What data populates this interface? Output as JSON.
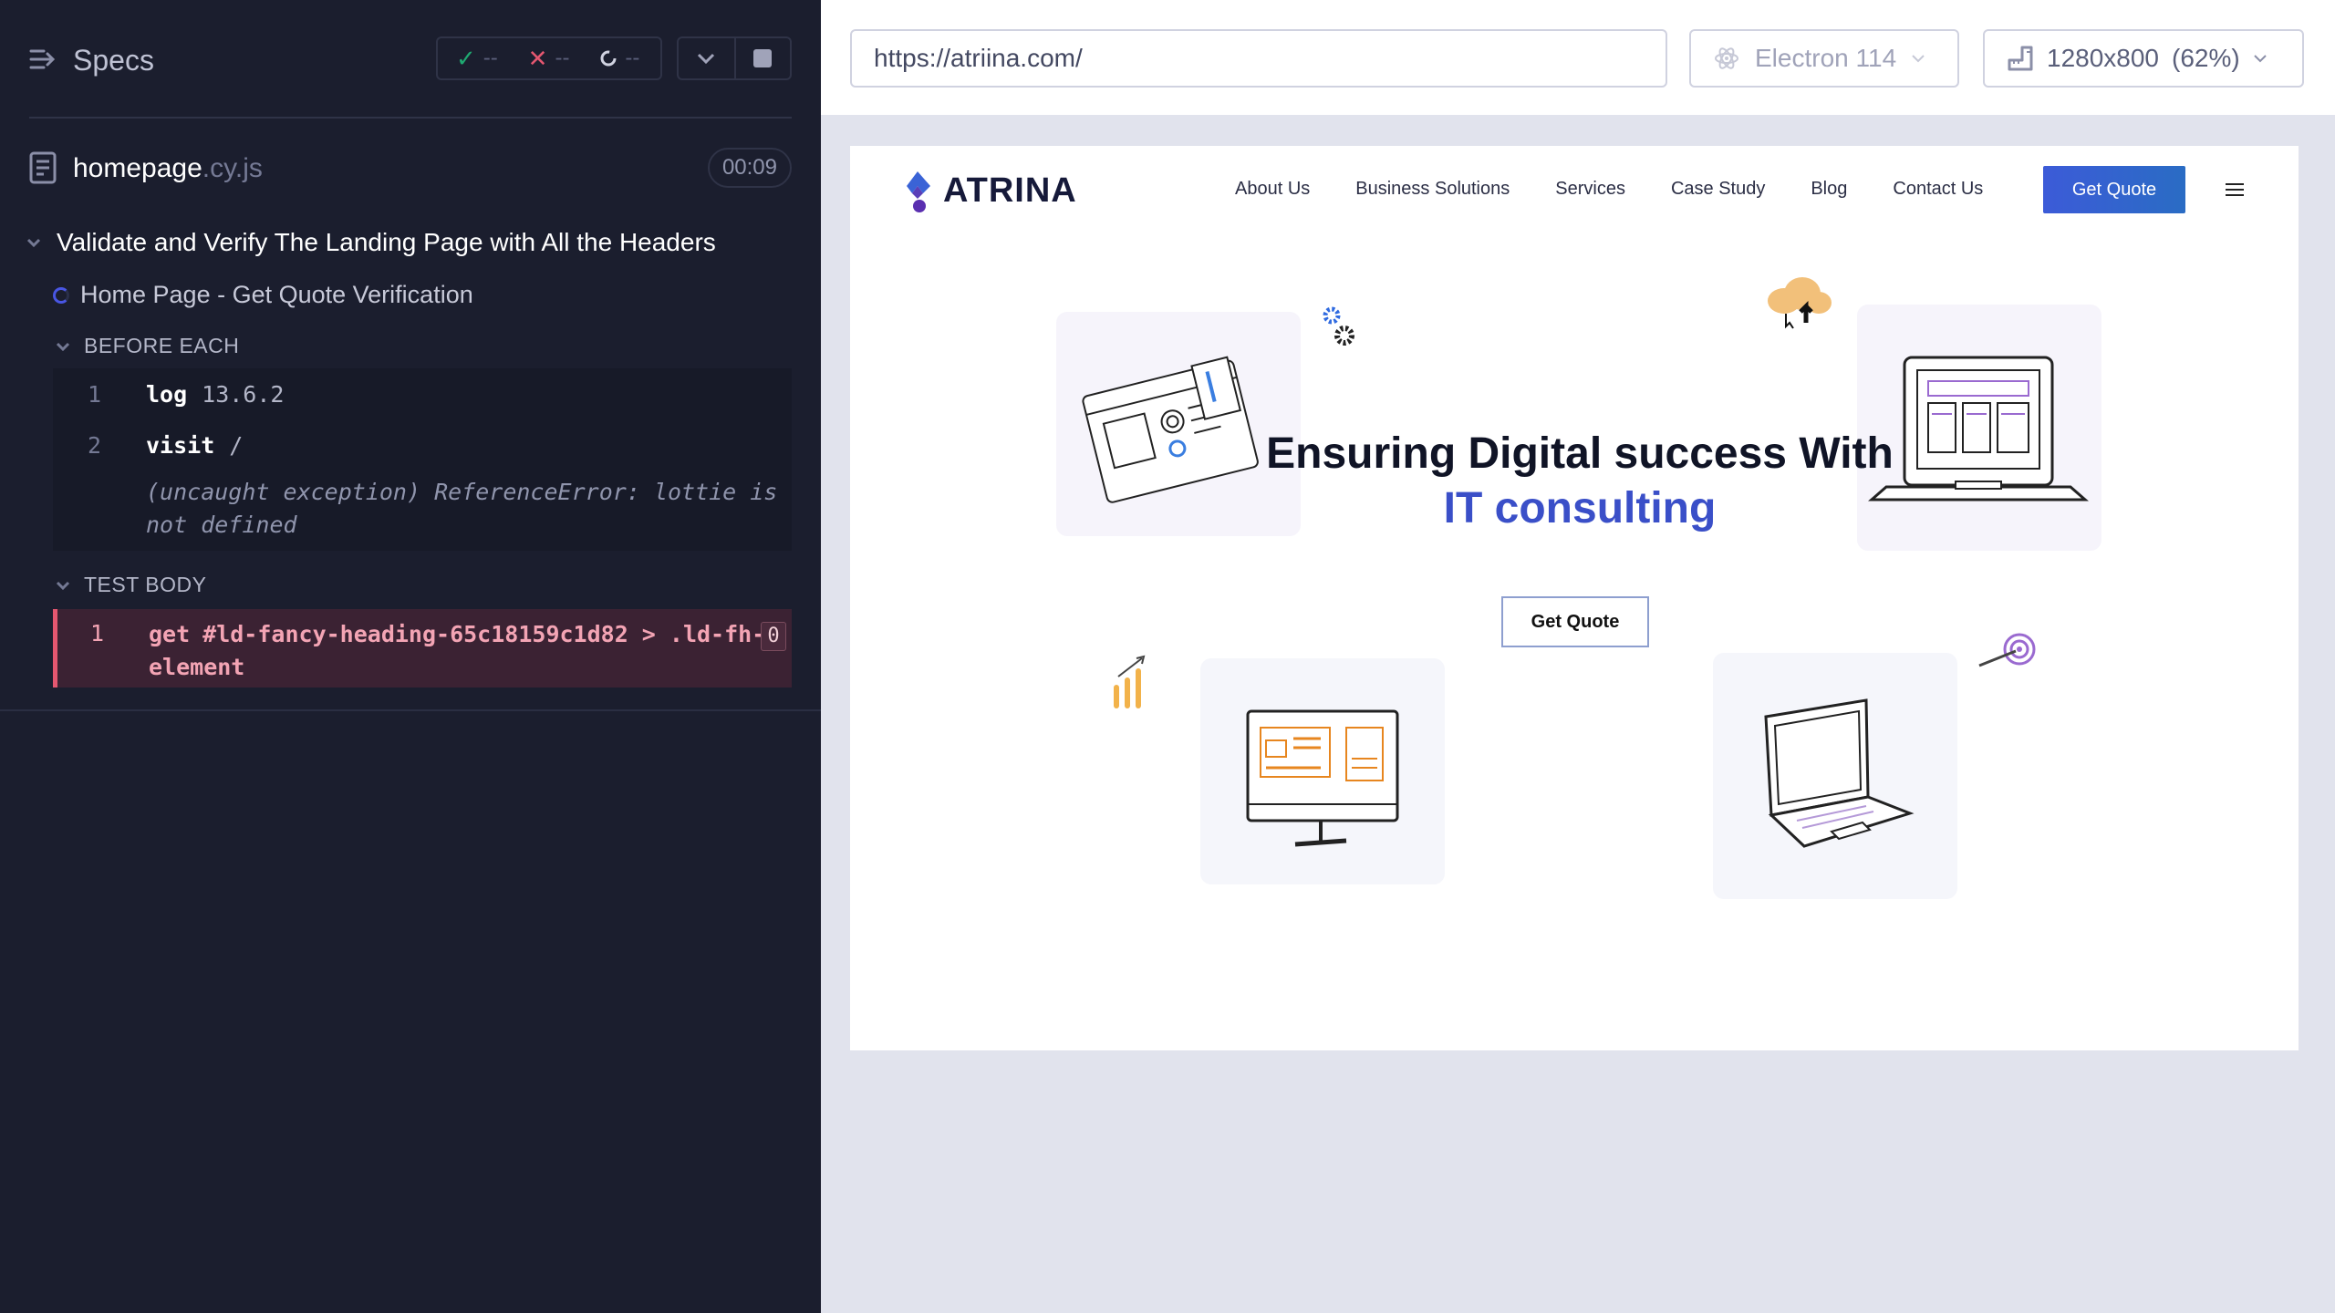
{
  "reporter": {
    "specs_label": "Specs",
    "stats": {
      "passed": "--",
      "failed": "--",
      "pending": "--"
    },
    "file": {
      "name": "homepage",
      "ext": ".cy.js",
      "duration": "00:09"
    },
    "suite_title": "Validate and Verify The Landing Page with All the Headers",
    "test_title": "Home Page - Get Quote Verification",
    "before_each": {
      "label": "BEFORE EACH",
      "commands": [
        {
          "num": "1",
          "name": "log",
          "arg": "13.6.2"
        },
        {
          "num": "2",
          "name": "visit",
          "arg": "/"
        }
      ],
      "exception": "(uncaught exception)  ReferenceError: lottie is not defined"
    },
    "test_body": {
      "label": "TEST BODY",
      "command": {
        "num": "1",
        "name": "get",
        "arg": "#ld-fancy-heading-65c18159c1d82 > .ld-fh-element",
        "count": "0"
      }
    }
  },
  "toolbar": {
    "url": "https://atriina.com/",
    "browser": "Electron 114",
    "viewport": "1280x800",
    "zoom": "(62%)"
  },
  "site": {
    "logo_text": "ATRINA",
    "nav": [
      "About Us",
      "Business Solutions",
      "Services",
      "Case Study",
      "Blog",
      "Contact Us"
    ],
    "cta": "Get Quote",
    "hero_line1": "Ensuring Digital success With",
    "hero_line2": "IT consulting",
    "hero_button": "Get Quote",
    "colors": {
      "brand": "#3a4fc8",
      "card_bg": "#f5f4fb"
    }
  },
  "colors": {
    "pass": "#1fa971",
    "fail": "#e45770",
    "reporter_bg": "#1b1e2e"
  }
}
